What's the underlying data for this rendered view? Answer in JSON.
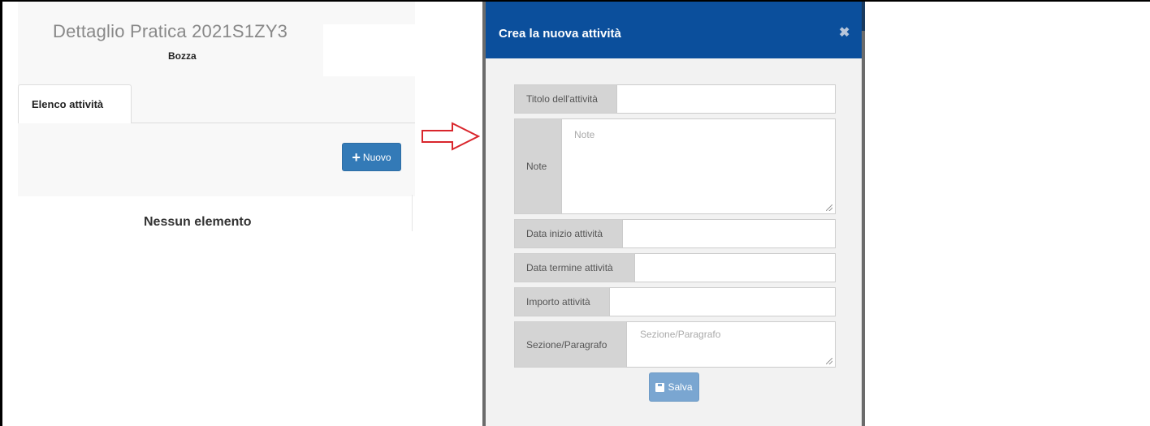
{
  "page": {
    "title": "Dettaglio Pratica 2021S1ZY3",
    "status": "Bozza",
    "tabs": [
      {
        "label": "Elenco attività"
      }
    ],
    "new_button": {
      "label": "Nuovo",
      "icon": "plus-icon"
    },
    "empty_message": "Nessun elemento"
  },
  "modal": {
    "title": "Crea la nuova attività",
    "close_label": "✖",
    "fields": {
      "title": {
        "label": "Titolo dell'attività",
        "value": "",
        "placeholder": ""
      },
      "notes": {
        "label": "Note",
        "value": "",
        "placeholder": "Note"
      },
      "start_date": {
        "label": "Data inizio attività",
        "value": "",
        "placeholder": ""
      },
      "end_date": {
        "label": "Data termine attività",
        "value": "",
        "placeholder": ""
      },
      "amount": {
        "label": "Importo attività",
        "value": "",
        "placeholder": ""
      },
      "section": {
        "label": "Sezione/Paragrafo",
        "value": "",
        "placeholder": "Sezione/Paragrafo"
      }
    },
    "save_button": {
      "label": "Salva",
      "icon": "floppy-disk-icon"
    }
  },
  "colors": {
    "modal_header": "#0b4f9c",
    "primary_button": "#337ab7",
    "arrow": "#d9262c"
  }
}
